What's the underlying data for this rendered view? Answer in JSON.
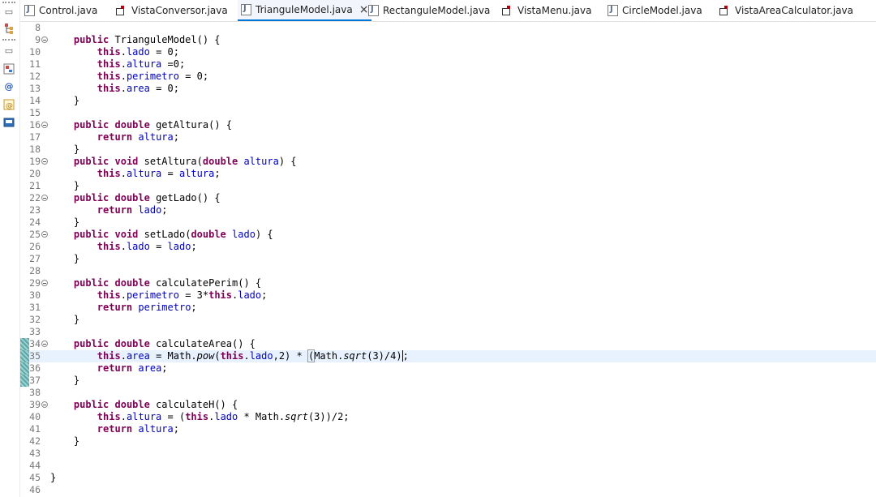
{
  "tabs": [
    {
      "label": "Control.java",
      "icon": "java-file-icon",
      "active": false
    },
    {
      "label": "VistaConversor.java",
      "icon": "java-class-main-icon",
      "active": false
    },
    {
      "label": "TrianguleModel.java",
      "icon": "java-file-icon",
      "active": true,
      "close": "×"
    },
    {
      "label": "RectanguleModel.java",
      "icon": "java-file-icon",
      "active": false
    },
    {
      "label": "VistaMenu.java",
      "icon": "java-class-main-icon",
      "active": false
    },
    {
      "label": "CircleModel.java",
      "icon": "java-file-icon",
      "active": false
    },
    {
      "label": "VistaAreaCalculator.java",
      "icon": "java-class-main-icon",
      "active": false
    }
  ],
  "left_toolbar": [
    "restore-icon",
    "hierarchy-icon",
    "restore-icon",
    "type-hierarchy-icon",
    "javadoc-icon",
    "declaration-icon",
    "console-icon"
  ],
  "current_line": 35,
  "lines": [
    {
      "n": "8",
      "text": ""
    },
    {
      "n": "9",
      "text": "    public TrianguleModel() {"
    },
    {
      "n": "10",
      "text": "        this.lado = 0;"
    },
    {
      "n": "11",
      "text": "        this.altura =0;"
    },
    {
      "n": "12",
      "text": "        this.perimetro = 0;"
    },
    {
      "n": "13",
      "text": "        this.area = 0;"
    },
    {
      "n": "14",
      "text": "    }"
    },
    {
      "n": "15",
      "text": ""
    },
    {
      "n": "16",
      "text": "    public double getAltura() {"
    },
    {
      "n": "17",
      "text": "        return altura;"
    },
    {
      "n": "18",
      "text": "    }"
    },
    {
      "n": "19",
      "text": "    public void setAltura(double altura) {"
    },
    {
      "n": "20",
      "text": "        this.altura = altura;"
    },
    {
      "n": "21",
      "text": "    }"
    },
    {
      "n": "22",
      "text": "    public double getLado() {"
    },
    {
      "n": "23",
      "text": "        return lado;"
    },
    {
      "n": "24",
      "text": "    }"
    },
    {
      "n": "25",
      "text": "    public void setLado(double lado) {"
    },
    {
      "n": "26",
      "text": "        this.lado = lado;"
    },
    {
      "n": "27",
      "text": "    }"
    },
    {
      "n": "28",
      "text": ""
    },
    {
      "n": "29",
      "text": "    public double calculatePerim() {"
    },
    {
      "n": "30",
      "text": "        this.perimetro = 3*this.lado;"
    },
    {
      "n": "31",
      "text": "        return perimetro;"
    },
    {
      "n": "32",
      "text": "    }"
    },
    {
      "n": "33",
      "text": ""
    },
    {
      "n": "34",
      "text": "    public double calculateArea() {"
    },
    {
      "n": "35",
      "text": "        this.area = Math.pow(this.lado,2) * (Math.sqrt(3)/4);"
    },
    {
      "n": "36",
      "text": "        return area;"
    },
    {
      "n": "37",
      "text": "    }"
    },
    {
      "n": "38",
      "text": ""
    },
    {
      "n": "39",
      "text": "    public double calculateH() {"
    },
    {
      "n": "40",
      "text": "        this.altura = (this.lado * Math.sqrt(3))/2;"
    },
    {
      "n": "41",
      "text": "        return altura;"
    },
    {
      "n": "42",
      "text": "    }"
    },
    {
      "n": "43",
      "text": ""
    },
    {
      "n": "44",
      "text": ""
    },
    {
      "n": "45",
      "text": "}"
    },
    {
      "n": "46",
      "text": ""
    }
  ],
  "folded_lines": [
    "9",
    "16",
    "19",
    "22",
    "25",
    "29",
    "34",
    "39"
  ],
  "changed_lines": [
    "34",
    "35",
    "36",
    "37"
  ],
  "colors": {
    "keyword": "#7f0055",
    "field": "#0000c0",
    "current_line": "#e8f2fe",
    "active_tab_underline": "#0078d7"
  }
}
